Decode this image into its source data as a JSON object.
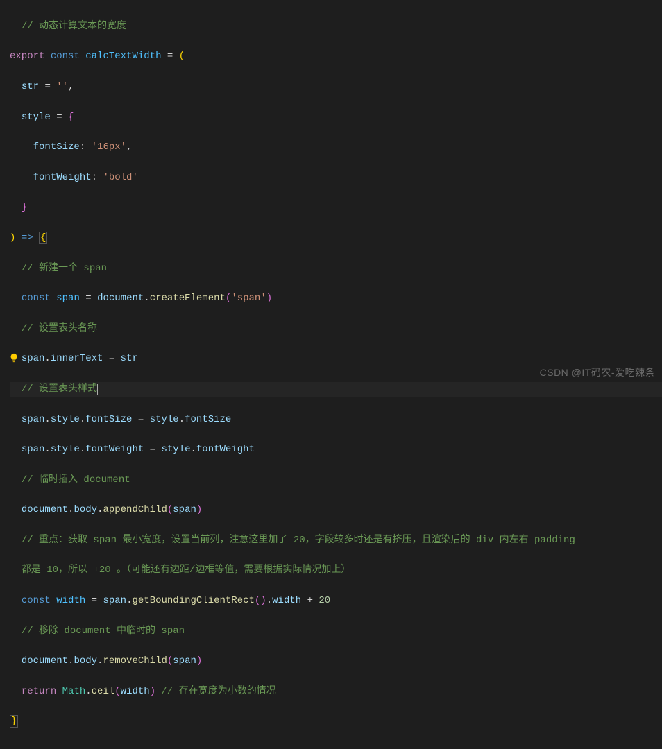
{
  "code": {
    "c1": "// 动态计算文本的宽度",
    "kw_export": "export",
    "kw_const": "const",
    "fn_name": "calcTextWidth",
    "eq": " = ",
    "lparen": "(",
    "param_str": "str",
    "str_empty": "''",
    "param_style": "style",
    "lbrace": "{",
    "prop_fontSize": "fontSize",
    "val_16px": "'16px'",
    "prop_fontWeight": "fontWeight",
    "val_bold": "'bold'",
    "rbrace": "}",
    "rparen": ")",
    "arrow": "=>",
    "c2": "// 新建一个 span",
    "var_span": "span",
    "obj_document": "document",
    "m_createElement": "createElement",
    "str_span": "'span'",
    "c3": "// 设置表头名称",
    "prop_innerText": "innerText",
    "var_str": "str",
    "c4": "// 设置表头样式",
    "prop_style": "style",
    "c5": "// 临时插入 document",
    "prop_body": "body",
    "m_appendChild": "appendChild",
    "c6a": "// 重点：获取 span 最小宽度，设置当前列，注意这里加了 20，字段较多时还是有挤压，且渲染后的 div 内左右 padding",
    "c6b": "都是 10，所以 +20 。（可能还有边距/边框等值，需要根据实际情况加上）",
    "var_width": "width",
    "m_getBoundingClientRect": "getBoundingClientRect",
    "prop_width": "width",
    "num_20": "20",
    "c7": "// 移除 document 中临时的 span",
    "m_removeChild": "removeChild",
    "kw_return": "return",
    "obj_Math": "Math",
    "m_ceil": "ceil",
    "c8": "// 存在宽度为小数的情况"
  },
  "watermark": "CSDN @IT码农-爱吃辣条"
}
